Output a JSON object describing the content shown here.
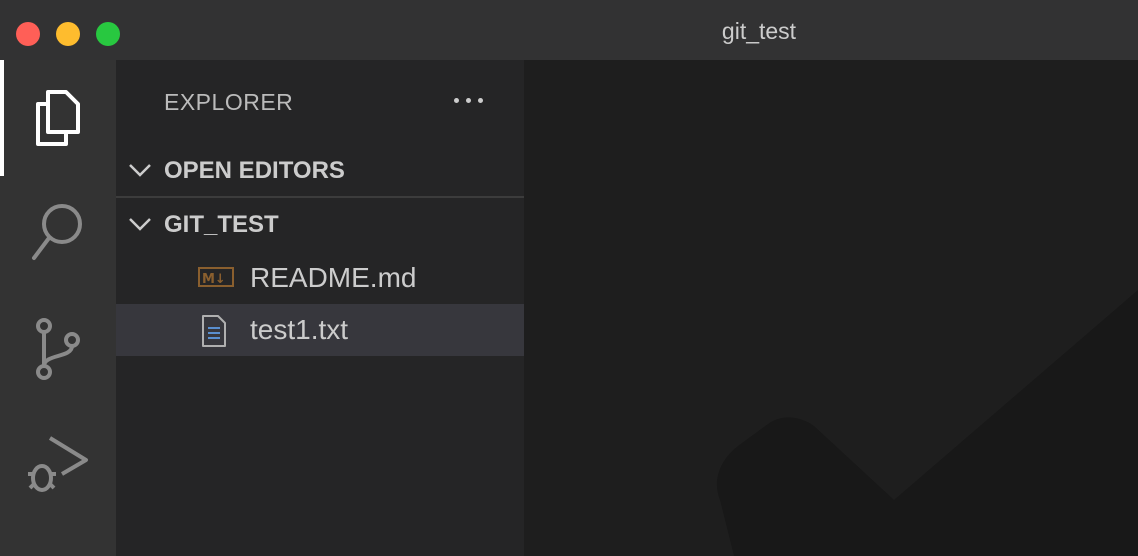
{
  "window": {
    "title": "git_test"
  },
  "sidebar": {
    "title": "EXPLORER",
    "sections": [
      {
        "label": "OPEN EDITORS"
      },
      {
        "label": "GIT_TEST"
      }
    ],
    "files": [
      {
        "name": "README.md",
        "icon": "markdown-icon",
        "icon_text": "M↓"
      },
      {
        "name": "test1.txt",
        "icon": "text-file-icon",
        "selected": true
      }
    ]
  },
  "activity_bar": {
    "items": [
      "explorer-icon",
      "search-icon",
      "source-control-icon",
      "run-debug-icon"
    ]
  },
  "colors": {
    "background": "#1e1e1e",
    "sidebar": "#252526",
    "activity_bar": "#333333",
    "selected_row": "#37373d",
    "markdown_icon": "#8a5f2e"
  }
}
